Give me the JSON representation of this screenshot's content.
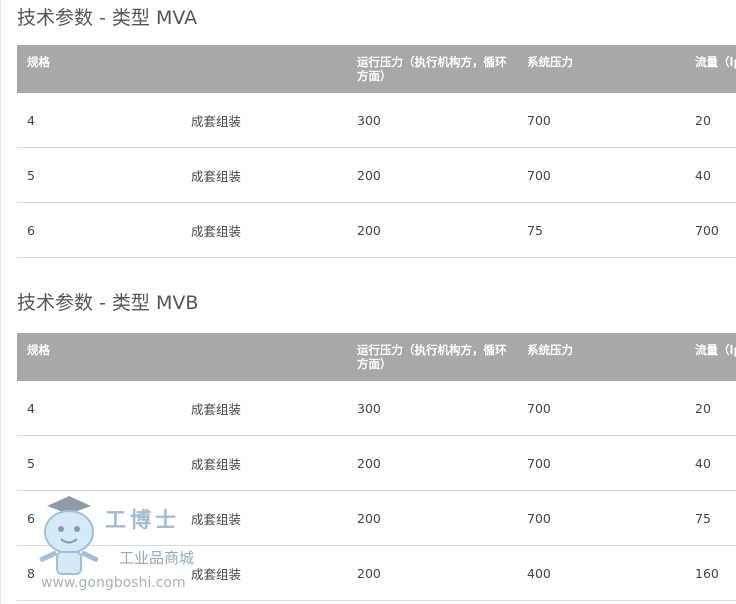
{
  "sections": [
    {
      "title": "技术参数 - 类型 MVA",
      "headers": [
        "规格",
        "",
        "运行压力（执行机构方，循环方面）",
        "系统压力",
        "流量（lpm）"
      ],
      "rows": [
        [
          "4",
          "成套组装",
          "300",
          "700",
          "20"
        ],
        [
          "5",
          "成套组装",
          "200",
          "700",
          "40"
        ],
        [
          "6",
          "成套组装",
          "200",
          "75",
          "700"
        ]
      ]
    },
    {
      "title": "技术参数 - 类型 MVB",
      "headers": [
        "规格",
        "",
        "运行压力（执行机构方，循环方面）",
        "系统压力",
        "流量（lpm）"
      ],
      "rows": [
        [
          "4",
          "成套组装",
          "300",
          "700",
          "20"
        ],
        [
          "5",
          "成套组装",
          "200",
          "700",
          "40"
        ],
        [
          "6",
          "成套组装",
          "200",
          "700",
          "75"
        ],
        [
          "8",
          "成套组装",
          "200",
          "400",
          "160"
        ]
      ]
    }
  ],
  "watermark": {
    "brand": "工博士",
    "subtitle": "工业品商城",
    "url": "www.gongboshi.com",
    "mascot_icon": "robot-mascot-icon",
    "colors": {
      "brand": "#9cb8d3",
      "header_bg": "#a8a8a8",
      "row_border": "#dadada"
    }
  }
}
